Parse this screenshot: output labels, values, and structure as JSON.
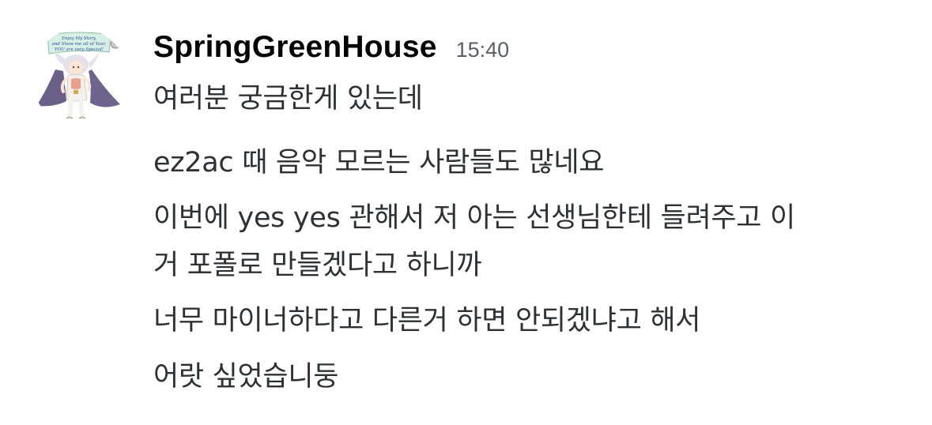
{
  "message": {
    "author": "SpringGreenHouse",
    "timestamp": "15:40",
    "avatar_icon": "anime-character-avatar",
    "avatar_banner": [
      "Enjoy My Story,",
      "and Show me all of Your,",
      "YOU are very Special!"
    ],
    "lines": [
      "여러분 궁금한게 있는데",
      "ez2ac 때 음악 모르는 사람들도 많네요",
      "이번에 yes yes 관해서 저 아는 선생님한테 들려주고 이",
      "거 포폴로 만들겠다고 하니까",
      "너무 마이너하다고 다른거 하면 안되겠냐고 해서",
      "어랏 싶었습니둥"
    ]
  },
  "colors": {
    "background": "#ffffff",
    "username": "#060607",
    "timestamp": "#5c5e66",
    "text": "#2e3035"
  }
}
